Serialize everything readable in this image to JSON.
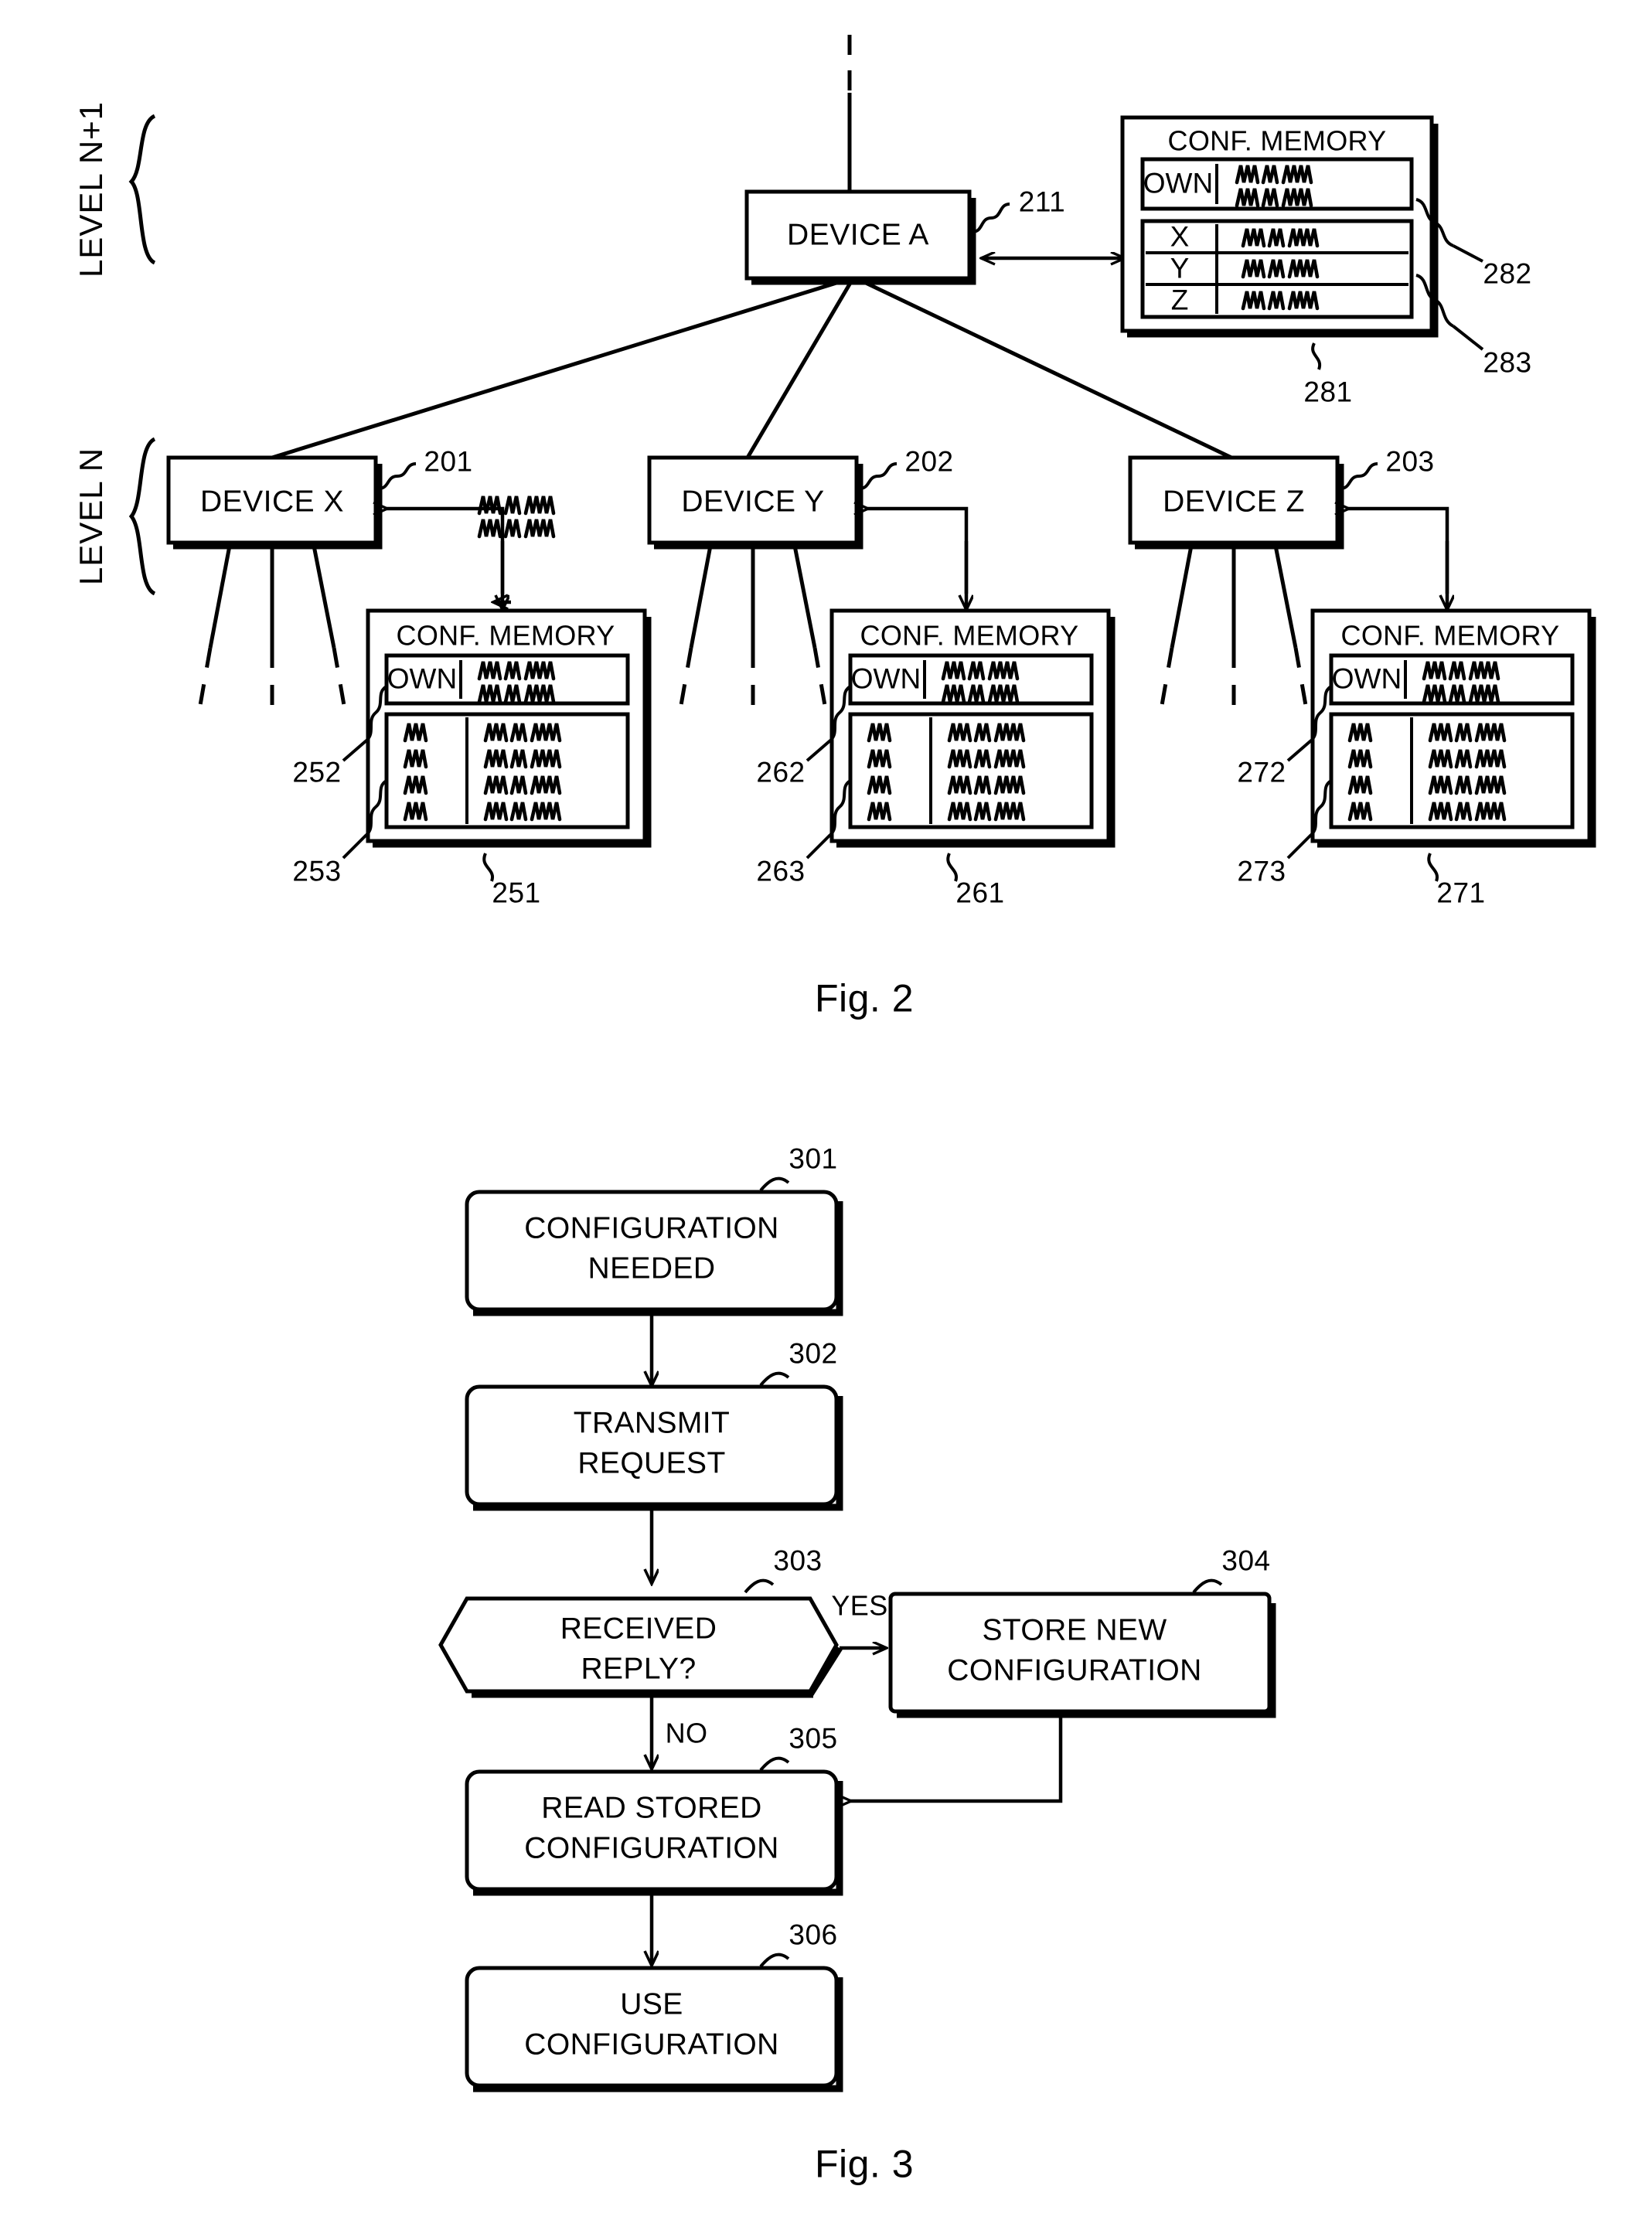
{
  "figures": [
    {
      "caption": "Fig. 2",
      "level_labels": [
        {
          "text": "LEVEL N+1"
        },
        {
          "text": "LEVEL N"
        }
      ],
      "nodes": [
        {
          "label": "DEVICE A",
          "ref": "211"
        },
        {
          "label": "DEVICE X",
          "ref": "201"
        },
        {
          "label": "DEVICE Y",
          "ref": "202"
        },
        {
          "label": "DEVICE Z",
          "ref": "203"
        }
      ],
      "memories": [
        {
          "title": "CONF. MEMORY",
          "owner": "DEVICE A",
          "own_row_label": "OWN",
          "rows": [
            "X",
            "Y",
            "Z"
          ],
          "refs": {
            "block": "281",
            "own": "282",
            "table": "283"
          }
        },
        {
          "title": "CONF. MEMORY",
          "owner": "DEVICE X",
          "own_row_label": "OWN",
          "rows": [
            "",
            "",
            "",
            ""
          ],
          "refs": {
            "block": "251",
            "own": "252",
            "table": "253"
          }
        },
        {
          "title": "CONF. MEMORY",
          "owner": "DEVICE Y",
          "own_row_label": "OWN",
          "rows": [
            "",
            "",
            "",
            ""
          ],
          "refs": {
            "block": "261",
            "own": "262",
            "table": "263"
          }
        },
        {
          "title": "CONF. MEMORY",
          "owner": "DEVICE Z",
          "own_row_label": "OWN",
          "rows": [
            "",
            "",
            "",
            ""
          ],
          "refs": {
            "block": "271",
            "own": "272",
            "table": "273"
          }
        }
      ]
    },
    {
      "caption": "Fig. 3",
      "steps": [
        {
          "ref": "301",
          "text": "CONFIGURATION\nNEEDED",
          "line1": "CONFIGURATION",
          "line2": "NEEDED",
          "shape": "box"
        },
        {
          "ref": "302",
          "text": "TRANSMIT\nREQUEST",
          "line1": "TRANSMIT",
          "line2": "REQUEST",
          "shape": "box"
        },
        {
          "ref": "303",
          "text": "RECEIVED\nREPLY?",
          "line1": "RECEIVED",
          "line2": "REPLY?",
          "shape": "hexagon"
        },
        {
          "ref": "304",
          "text": "STORE NEW\nCONFIGURATION",
          "line1": "STORE NEW",
          "line2": "CONFIGURATION",
          "shape": "box"
        },
        {
          "ref": "305",
          "text": "READ STORED\nCONFIGURATION",
          "line1": "READ STORED",
          "line2": "CONFIGURATION",
          "shape": "box"
        },
        {
          "ref": "306",
          "text": "USE\nCONFIGURATION",
          "line1": "USE",
          "line2": "CONFIGURATION",
          "shape": "box"
        }
      ],
      "branch_labels": [
        {
          "text": "YES"
        },
        {
          "text": "NO"
        }
      ]
    }
  ],
  "colors": {
    "ink": "#000000",
    "paper": "#ffffff"
  }
}
